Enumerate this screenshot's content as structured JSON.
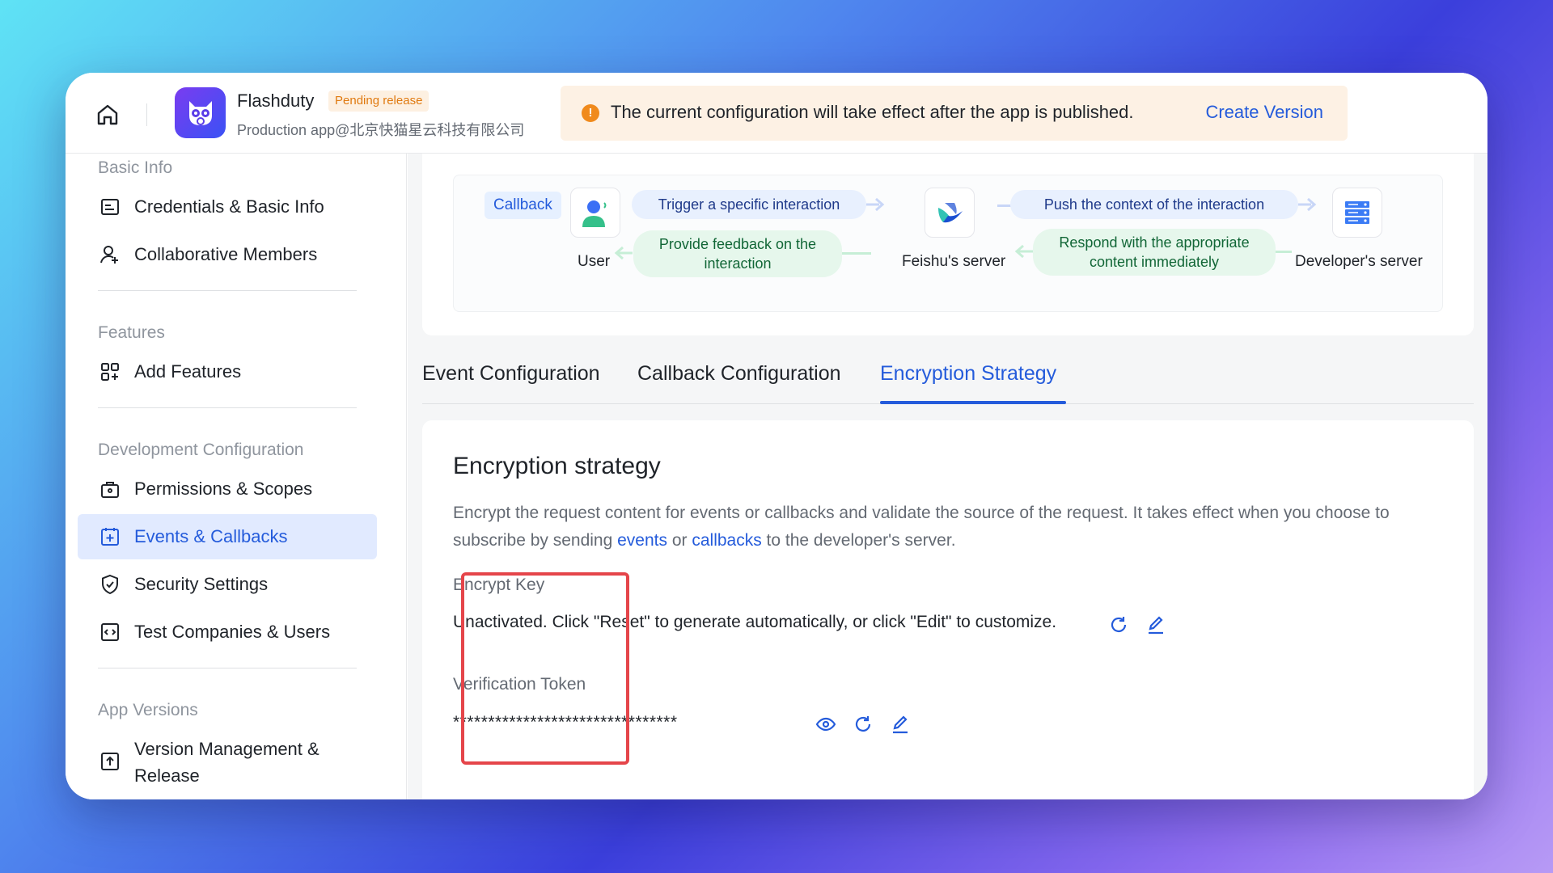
{
  "header": {
    "app_name": "Flashduty",
    "badge": "Pending release",
    "subtitle": "Production app@北京快猫星云科技有限公司",
    "notice_text": "The current configuration will take effect after the app is published.",
    "notice_link": "Create Version"
  },
  "sidebar": {
    "sections": {
      "basic": "Basic Info",
      "features": "Features",
      "dev": "Development Configuration",
      "versions": "App Versions"
    },
    "items": [
      {
        "label": "Credentials & Basic Info",
        "icon": "id-card-icon"
      },
      {
        "label": "Collaborative Members",
        "icon": "add-member-icon"
      },
      {
        "label": "Add Features",
        "icon": "apps-grid-icon"
      },
      {
        "label": "Permissions & Scopes",
        "icon": "briefcase-lock-icon"
      },
      {
        "label": "Events & Callbacks",
        "icon": "event-add-icon",
        "active": true
      },
      {
        "label": "Security Settings",
        "icon": "shield-check-icon"
      },
      {
        "label": "Test Companies & Users",
        "icon": "code-window-icon"
      },
      {
        "label": "Version Management & Release",
        "icon": "upload-box-icon"
      }
    ],
    "versions_line1": "Version Management &",
    "versions_line2": "Release"
  },
  "diagram": {
    "tag": "Callback",
    "user": "User",
    "server": "Feishu's server",
    "dev_server": "Developer's server",
    "trigger": "Trigger a specific interaction",
    "feedback_line1": "Provide feedback on the",
    "feedback_line2": "interaction",
    "push": "Push the context of the interaction",
    "respond_line1": "Respond with the appropriate",
    "respond_line2": "content immediately"
  },
  "tabs": [
    {
      "label": "Event Configuration"
    },
    {
      "label": "Callback Configuration"
    },
    {
      "label": "Encryption Strategy",
      "active": true
    }
  ],
  "encryption": {
    "title": "Encryption strategy",
    "desc_part1": "Encrypt the request content for events or callbacks and validate the source of the request. It takes effect when you choose to subscribe by sending ",
    "desc_link1": "events",
    "desc_mid": " or ",
    "desc_link2": "callbacks",
    "desc_part2": " to the developer's server.",
    "encrypt_key_label": "Encrypt Key",
    "encrypt_key_value": "Unactivated. Click \"Reset\" to generate automatically, or click \"Edit\" to customize.",
    "token_label": "Verification Token",
    "token_value": "********************************"
  },
  "colors": {
    "accent": "#245bdb",
    "active_bg": "#e1eaff",
    "warning": "#f08a1c",
    "highlight": "#e5454a"
  }
}
